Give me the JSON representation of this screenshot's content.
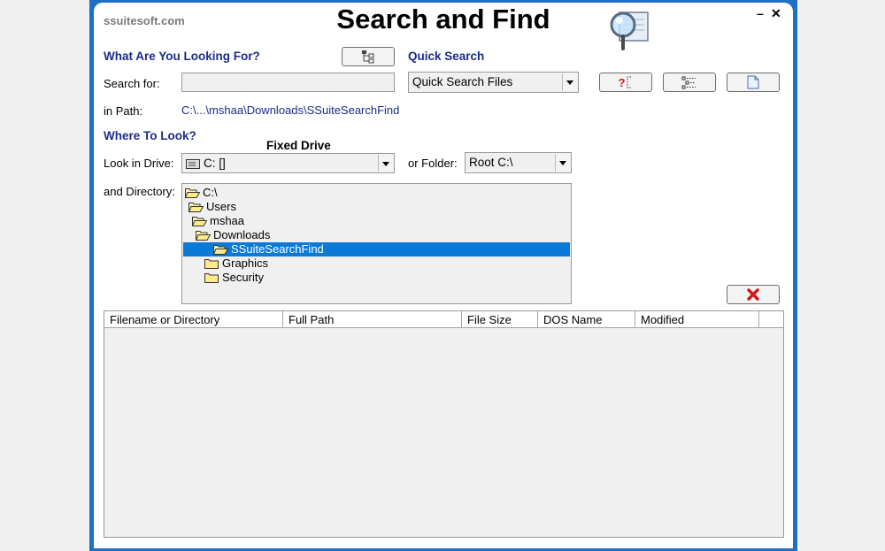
{
  "header": {
    "brand": "ssuitesoft.com",
    "title": "Search and Find",
    "minimize_glyph": "–",
    "close_glyph": "✕",
    "logo_icon": "magnifier-icon"
  },
  "what_section": {
    "heading": "What Are You Looking For?",
    "search_for_label": "Search for:",
    "search_for_value": "",
    "in_path_label": "in Path:",
    "in_path_value": "C:\\...\\mshaa\\Downloads\\SSuiteSearchFind"
  },
  "quick_search": {
    "heading": "Quick Search",
    "selected": "Quick Search Files",
    "buttons": [
      {
        "name": "help-button",
        "icon": "help-icon",
        "glyph": "?"
      },
      {
        "name": "options-button",
        "icon": "options-icon"
      },
      {
        "name": "document-button",
        "icon": "document-icon"
      }
    ]
  },
  "where_section": {
    "heading": "Where To Look?",
    "drive_type_label": "Fixed Drive",
    "look_in_drive_label": "Look in Drive:",
    "drive_value": "C: []",
    "or_folder_label": "or Folder:",
    "folder_value": "Root C:\\",
    "and_directory_label": "and Directory:"
  },
  "directory_tree": [
    {
      "label": "C:\\",
      "level": 0,
      "selected": false,
      "open": true
    },
    {
      "label": "Users",
      "level": 1,
      "selected": false,
      "open": true
    },
    {
      "label": "mshaa",
      "level": 2,
      "selected": false,
      "open": true
    },
    {
      "label": "Downloads",
      "level": 3,
      "selected": false,
      "open": true
    },
    {
      "label": "SSuiteSearchFind",
      "level": 4,
      "selected": true,
      "open": true
    },
    {
      "label": "Graphics",
      "level": 5,
      "selected": false,
      "open": false
    },
    {
      "label": "Security",
      "level": 5,
      "selected": false,
      "open": false
    }
  ],
  "results": {
    "columns": [
      "Filename or Directory",
      "Full Path",
      "File Size",
      "DOS Name",
      "Modified"
    ],
    "rows": []
  },
  "colors": {
    "frame": "#1f6fc4",
    "heading": "#1a2b8c",
    "selection": "#0a7ad6",
    "cancel_red": "#d11a1a"
  }
}
